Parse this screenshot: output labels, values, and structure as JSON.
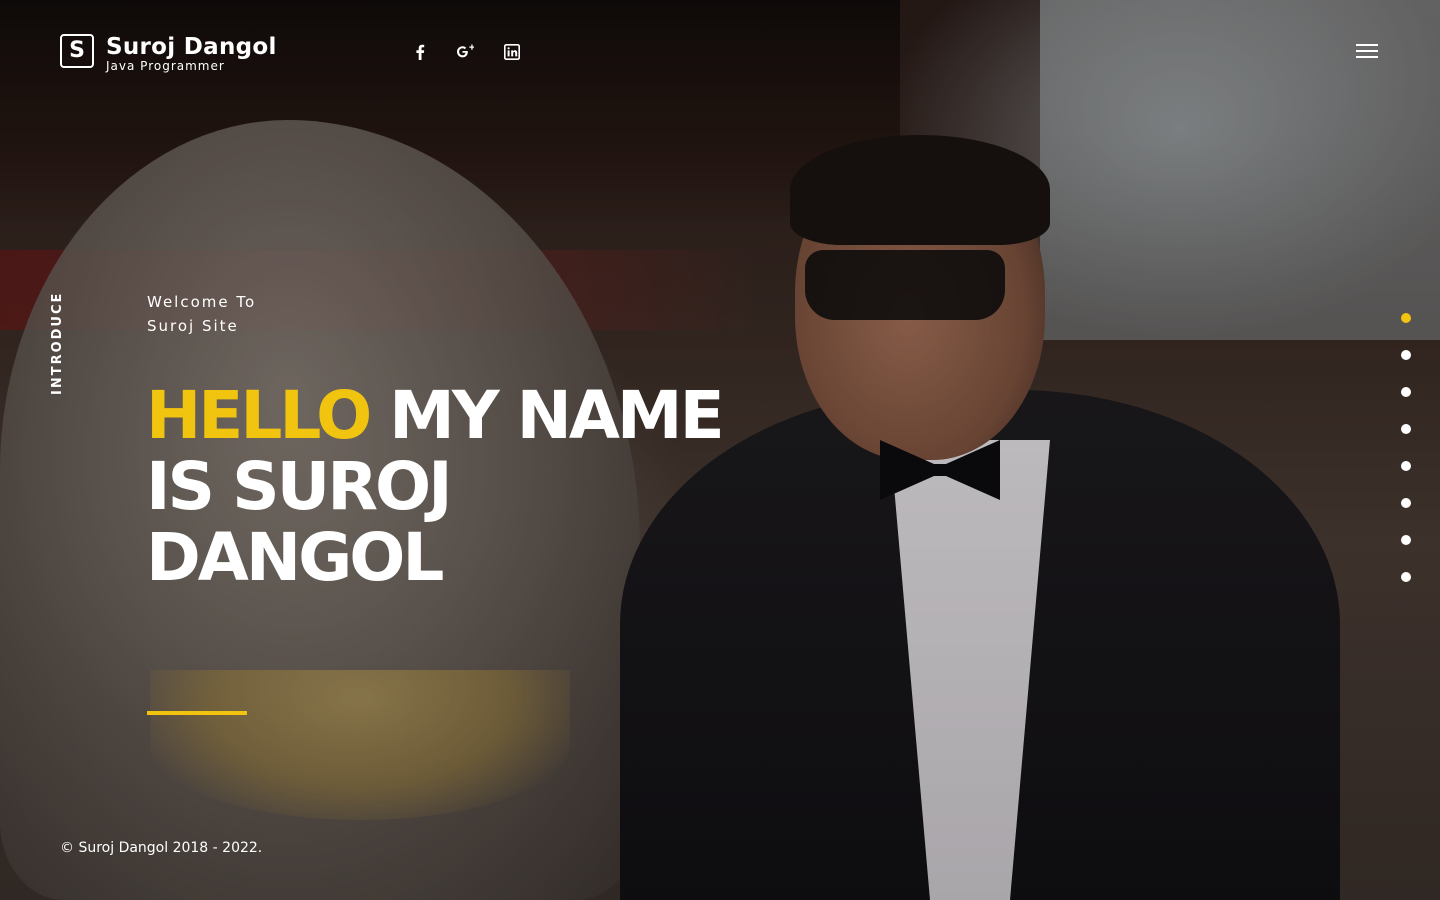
{
  "brand": {
    "logo_letter": "S",
    "name": "Suroj Dangol",
    "role": "Java Programmer"
  },
  "social": [
    {
      "icon": "facebook-icon",
      "glyph": "f"
    },
    {
      "icon": "google-plus-icon",
      "glyph": "g+"
    },
    {
      "icon": "linkedin-icon",
      "glyph": "in"
    }
  ],
  "menu": {
    "icon": "hamburger-menu-icon"
  },
  "section_label": "INTRODUCE",
  "hero": {
    "welcome_line1": "Welcome To",
    "welcome_line2": "Suroj Site",
    "headline_highlight": "HELLO",
    "headline_rest_line1": " MY NAME",
    "headline_line2": "IS SUROJ",
    "headline_line3": "DANGOL"
  },
  "footer": {
    "copyright": "© Suroj Dangol 2018 - 2022."
  },
  "nav_dots": {
    "count": 8,
    "active_index": 0
  },
  "colors": {
    "accent": "#f1c40f",
    "text": "#ffffff"
  }
}
